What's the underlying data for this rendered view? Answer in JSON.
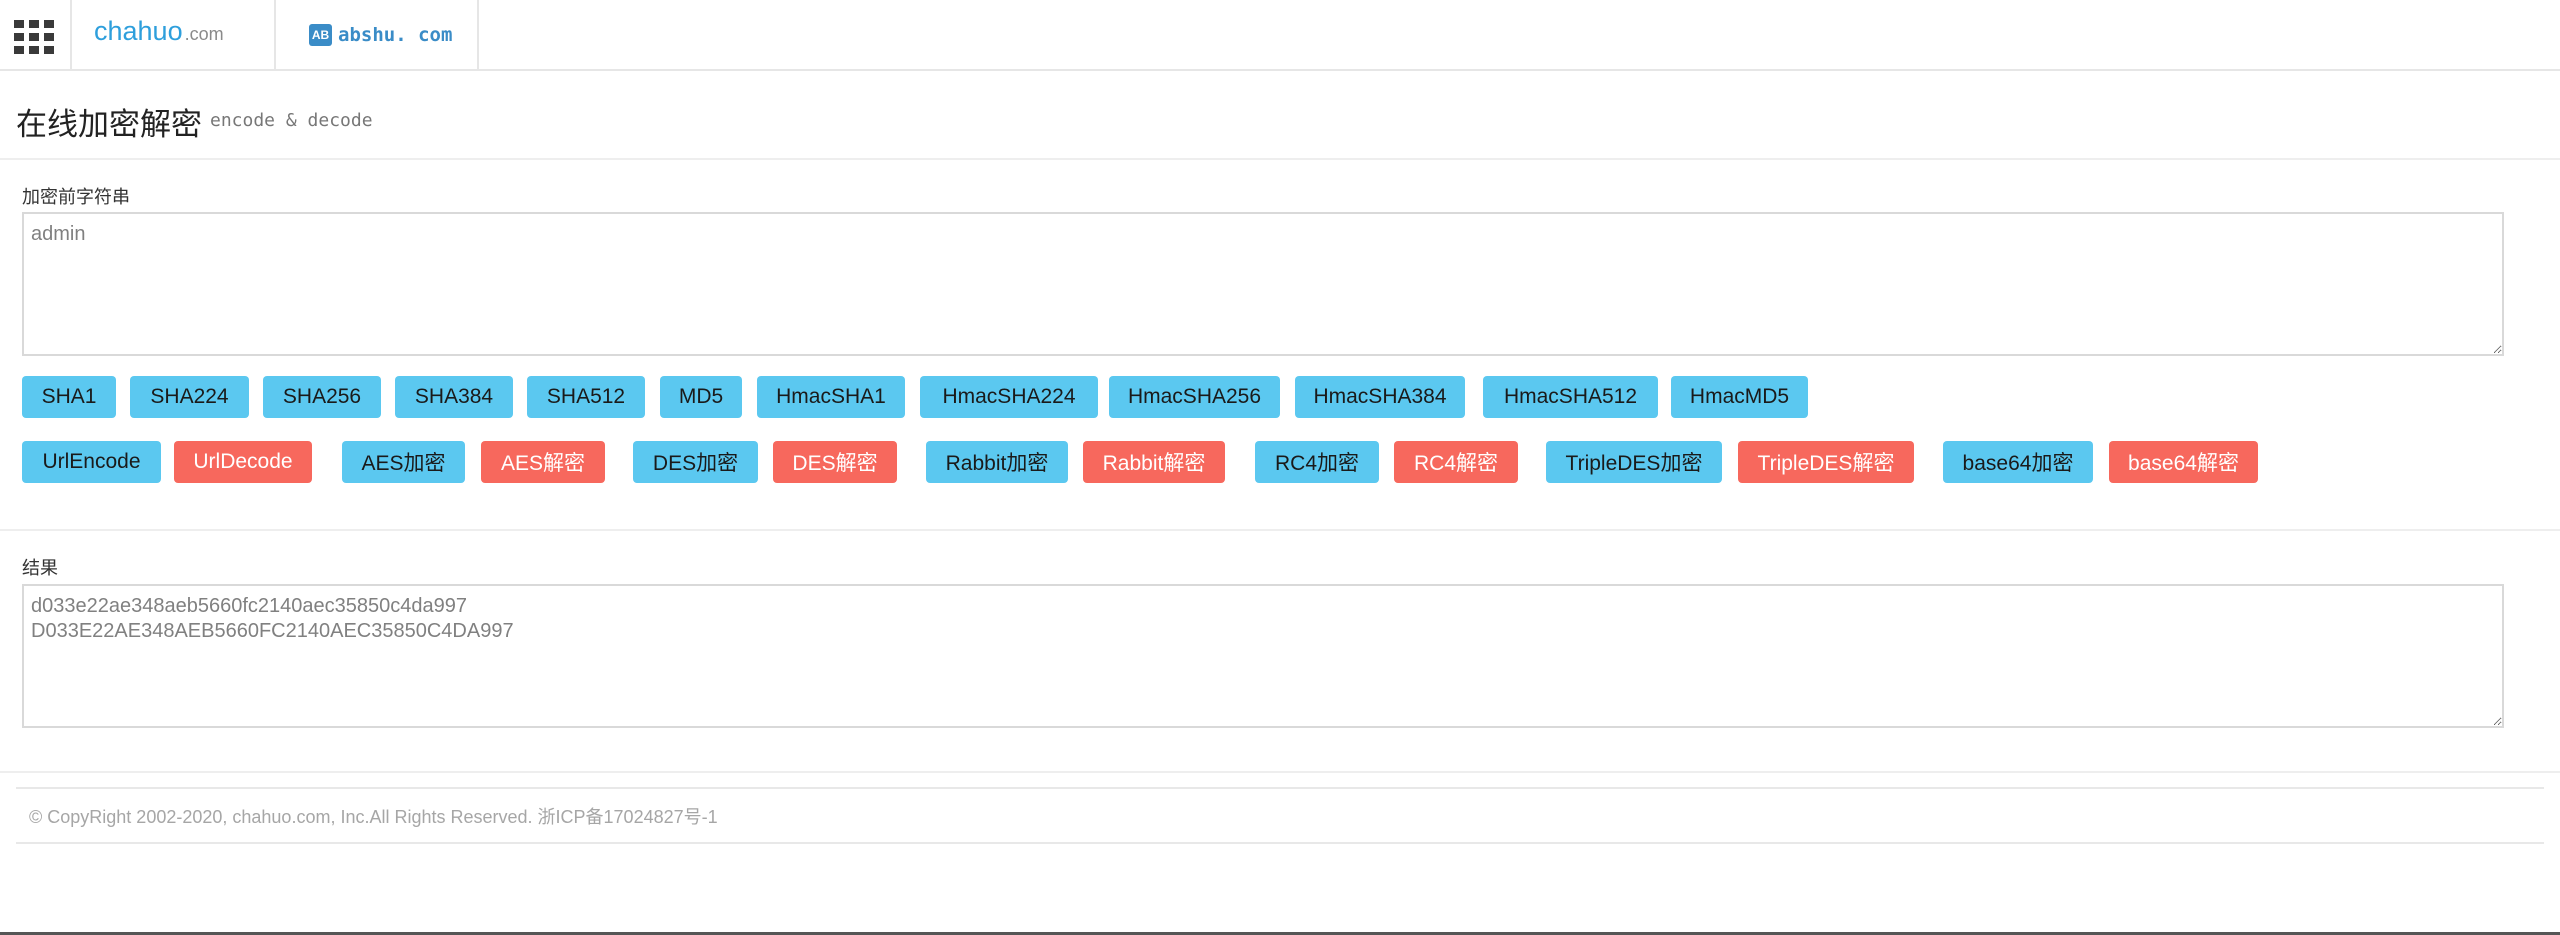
{
  "topbar": {
    "menu_icon": "grid-menu-icon",
    "logo1": {
      "main": "chahuo",
      "suffix": ".com"
    },
    "logo2": {
      "badge": "AB",
      "text": "abshu. com"
    }
  },
  "header": {
    "title": "在线加密解密",
    "subtitle": "encode & decode"
  },
  "input": {
    "label": "加密前字符串",
    "value": "admin"
  },
  "hash_buttons": [
    {
      "label": "SHA1",
      "color": "#5bc8f0"
    },
    {
      "label": "SHA224",
      "color": "#5bc8f0"
    },
    {
      "label": "SHA256",
      "color": "#5bc8f0"
    },
    {
      "label": "SHA384",
      "color": "#5bc8f0"
    },
    {
      "label": "SHA512",
      "color": "#5bc8f0"
    },
    {
      "label": "MD5",
      "color": "#5bc8f0"
    },
    {
      "label": "HmacSHA1",
      "color": "#5bc8f0"
    },
    {
      "label": "HmacSHA224",
      "color": "#5bc8f0"
    },
    {
      "label": "HmacSHA256",
      "color": "#5bc8f0"
    },
    {
      "label": "HmacSHA384",
      "color": "#5bc8f0"
    },
    {
      "label": "HmacSHA512",
      "color": "#5bc8f0"
    },
    {
      "label": "HmacMD5",
      "color": "#5bc8f0"
    }
  ],
  "codec_buttons": [
    {
      "label": "UrlEncode",
      "color": "#5bc8f0"
    },
    {
      "label": "UrlDecode",
      "color": "#f7685d"
    },
    {
      "label": "AES加密",
      "color": "#5bc8f0"
    },
    {
      "label": "AES解密",
      "color": "#f7685d"
    },
    {
      "label": "DES加密",
      "color": "#5bc8f0"
    },
    {
      "label": "DES解密",
      "color": "#f7685d"
    },
    {
      "label": "Rabbit加密",
      "color": "#5bc8f0"
    },
    {
      "label": "Rabbit解密",
      "color": "#f7685d"
    },
    {
      "label": "RC4加密",
      "color": "#5bc8f0"
    },
    {
      "label": "RC4解密",
      "color": "#f7685d"
    },
    {
      "label": "TripleDES加密",
      "color": "#5bc8f0"
    },
    {
      "label": "TripleDES解密",
      "color": "#f7685d"
    },
    {
      "label": "base64加密",
      "color": "#5bc8f0"
    },
    {
      "label": "base64解密",
      "color": "#f7685d"
    }
  ],
  "result": {
    "label": "结果",
    "value": "d033e22ae348aeb5660fc2140aec35850c4da997\nD033E22AE348AEB5660FC2140AEC35850C4DA997"
  },
  "footer": {
    "copyright": "© CopyRight 2002-2020, chahuo.com, Inc.All Rights Reserved. 浙ICP备17024827号-1"
  }
}
